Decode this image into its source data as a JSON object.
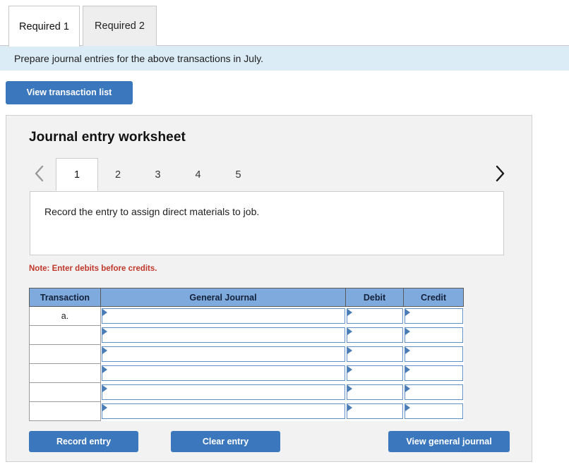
{
  "required_tabs": [
    {
      "label": "Required 1",
      "active": true
    },
    {
      "label": "Required 2",
      "active": false
    }
  ],
  "instruction": "Prepare journal entries for the above transactions in July.",
  "view_transaction_list_label": "View transaction list",
  "worksheet": {
    "title": "Journal entry worksheet",
    "pager": {
      "prev_icon": "chevron-left-icon",
      "next_icon": "chevron-right-icon",
      "pages": [
        {
          "label": "1",
          "active": true
        },
        {
          "label": "2",
          "active": false
        },
        {
          "label": "3",
          "active": false
        },
        {
          "label": "4",
          "active": false
        },
        {
          "label": "5",
          "active": false
        }
      ]
    },
    "entry_description": "Record the entry to assign direct materials to job.",
    "note": "Note: Enter debits before credits.",
    "table": {
      "headers": [
        "Transaction",
        "General Journal",
        "Debit",
        "Credit"
      ],
      "rows": [
        {
          "transaction": "a.",
          "general_journal": "",
          "debit": "",
          "credit": ""
        },
        {
          "transaction": "",
          "general_journal": "",
          "debit": "",
          "credit": ""
        },
        {
          "transaction": "",
          "general_journal": "",
          "debit": "",
          "credit": ""
        },
        {
          "transaction": "",
          "general_journal": "",
          "debit": "",
          "credit": ""
        },
        {
          "transaction": "",
          "general_journal": "",
          "debit": "",
          "credit": ""
        },
        {
          "transaction": "",
          "general_journal": "",
          "debit": "",
          "credit": ""
        }
      ]
    },
    "buttons": {
      "record_entry": "Record entry",
      "clear_entry": "Clear entry",
      "view_general_journal": "View general journal"
    }
  },
  "colors": {
    "primary_button": "#3a77bd",
    "instruction_bar": "#dcecf7",
    "table_header": "#7eaadd",
    "note_text": "#c0392b",
    "panel_background": "#f2f2f2",
    "input_border": "#5f8fc4"
  }
}
